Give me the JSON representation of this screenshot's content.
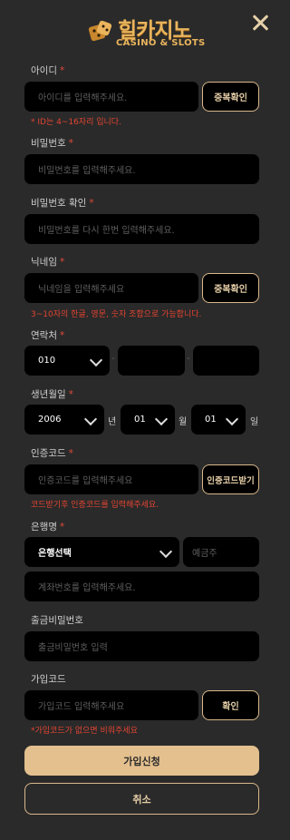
{
  "logo": {
    "text_ko": "힐카지노",
    "text_en": "CASINO & SLOTS"
  },
  "required_mark": "*",
  "userid": {
    "label": "아이디",
    "placeholder": "아이디를 입력해주세요.",
    "button": "중복확인",
    "hint": "* ID는 4~16자리 입니다."
  },
  "password": {
    "label": "비밀번호",
    "placeholder": "비밀번호를 입력해주세요."
  },
  "password_confirm": {
    "label": "비밀번호 확인",
    "placeholder": "비밀번호를 다시 한번 입력해주세요."
  },
  "nickname": {
    "label": "닉네임",
    "placeholder": "닉네임을 입력해주세요",
    "button": "중복확인",
    "hint": "3~10자의 한글, 영문, 숫자 조합으로 가능합니다."
  },
  "phone": {
    "label": "연락처",
    "prefix": "010",
    "dash": "-"
  },
  "birth": {
    "label": "생년월일",
    "year": "2006",
    "year_unit": "년",
    "month": "01",
    "month_unit": "월",
    "day": "01",
    "day_unit": "일"
  },
  "auth": {
    "label": "인증코드",
    "placeholder": "인증코드를 입력해주세요",
    "button": "인증코드받기",
    "hint": "코드받기후 인증코드를 입력해주세요."
  },
  "bank": {
    "label": "은행명",
    "select": "은행선택",
    "holder_placeholder": "예금주",
    "account_placeholder": "계좌번호를 입력해주세요."
  },
  "withdraw_pw": {
    "label": "출금비밀번호",
    "placeholder": "출금비밀번호 입력"
  },
  "join_code": {
    "label": "가입코드",
    "placeholder": "가입코드 입력해주세요",
    "button": "확인",
    "hint": "*가입코드가 없으면 비워주세요"
  },
  "actions": {
    "submit": "가입신청",
    "cancel": "취소"
  },
  "colors": {
    "accent": "#e4c08e",
    "error": "#e34431",
    "field_bg": "#000000",
    "page_bg": "#2a2a2a"
  }
}
